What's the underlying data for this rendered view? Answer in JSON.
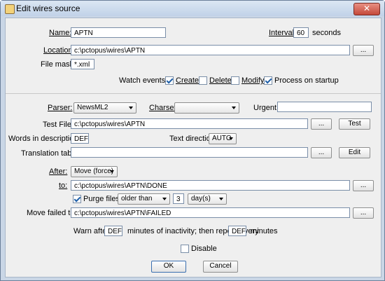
{
  "window": {
    "title": "Edit wires source",
    "close_glyph": "✕"
  },
  "name": {
    "label": "Name:",
    "value": "APTN"
  },
  "interval": {
    "label": "Interval:",
    "value": "60",
    "unit": "seconds"
  },
  "location": {
    "label": "Location:",
    "value": "c:\\pctopus\\wires\\APTN",
    "browse": "..."
  },
  "file_mask": {
    "label": "File mask:",
    "value": "*.xml"
  },
  "watch_events": {
    "label": "Watch events:",
    "create": {
      "label": "Create",
      "checked": true
    },
    "delete": {
      "label": "Delete",
      "checked": false
    },
    "modify": {
      "label": "Modify",
      "checked": false
    },
    "process_on_startup": {
      "label": "Process on startup",
      "checked": true
    }
  },
  "parser": {
    "label": "Parser:",
    "value": "NewsML2"
  },
  "charset": {
    "label": "Charset:",
    "value": ""
  },
  "urgent": {
    "label": "Urgent:",
    "value": ""
  },
  "test_file": {
    "label": "Test File:",
    "value": "c:\\pctopus\\wires\\APTN",
    "browse": "...",
    "test_btn": "Test"
  },
  "words_desc": {
    "label": "Words in description:",
    "value": "DEF"
  },
  "text_direction": {
    "label": "Text direction:",
    "value": "AUTO"
  },
  "translation": {
    "label": "Translation table:",
    "value": "",
    "browse": "...",
    "edit_btn": "Edit"
  },
  "after": {
    "label": "After:",
    "value": "Move (force)"
  },
  "to": {
    "label": "to:",
    "value": "c:\\pctopus\\wires\\APTN\\DONE",
    "browse": "..."
  },
  "purge": {
    "label": "Purge files",
    "checked": true,
    "mode": "older than",
    "count": "3",
    "unit": "day(s)"
  },
  "move_failed": {
    "label": "Move failed to:",
    "value": "c:\\pctopus\\wires\\APTN\\FAILED",
    "browse": "..."
  },
  "warn": {
    "prefix": "Warn after",
    "value1": "DEF",
    "middle": "minutes of inactivity; then repeat every",
    "value2": "DEF",
    "suffix": "minutes"
  },
  "disable": {
    "label": "Disable",
    "checked": false
  },
  "buttons": {
    "ok": "OK",
    "cancel": "Cancel"
  }
}
